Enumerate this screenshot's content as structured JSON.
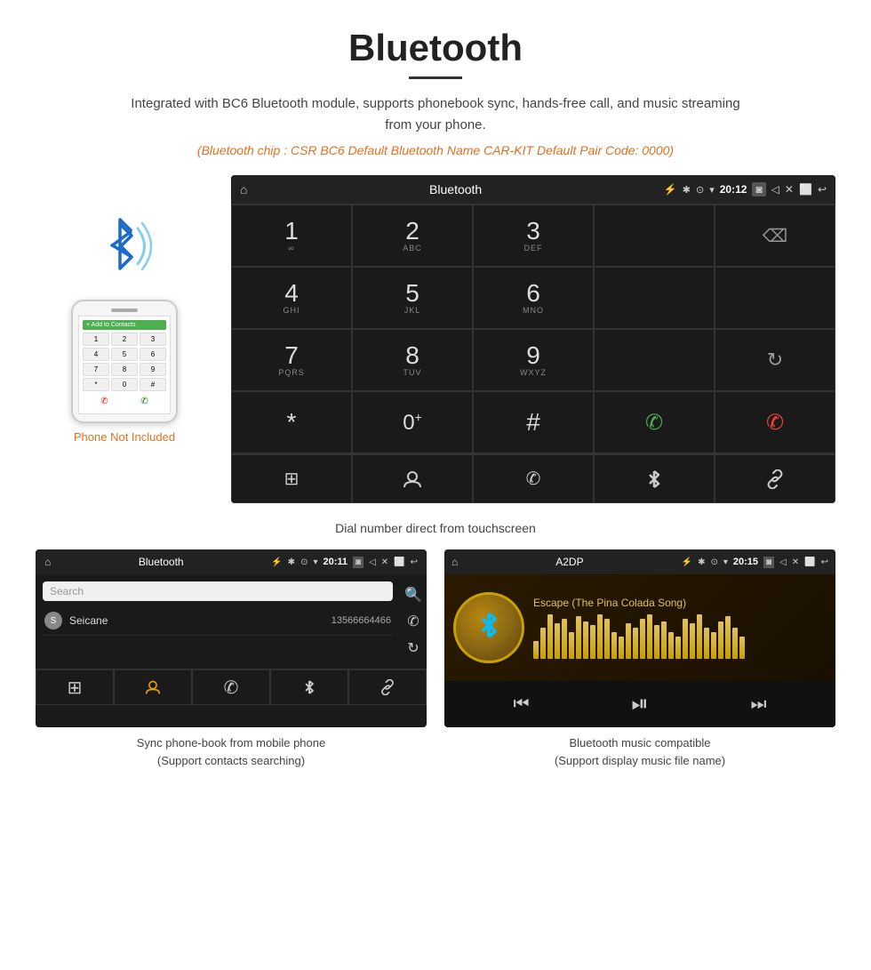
{
  "page": {
    "title": "Bluetooth",
    "title_underline": true,
    "subtitle": "Integrated with BC6 Bluetooth module, supports phonebook sync, hands-free call, and music streaming from your phone.",
    "info_line": "(Bluetooth chip : CSR BC6    Default Bluetooth Name CAR-KIT    Default Pair Code: 0000)"
  },
  "dialer": {
    "status_bar": {
      "home_icon": "⌂",
      "title": "Bluetooth",
      "usb_icon": "⚡",
      "bt_icon": "✱",
      "location_icon": "⊙",
      "signal_icon": "▾",
      "time": "20:12",
      "camera_icon": "◙",
      "volume_icon": "◁",
      "close_icon": "✕",
      "window_icon": "⬜",
      "back_icon": "↩"
    },
    "keys": [
      {
        "number": "1",
        "letters": "∞",
        "row": 0,
        "col": 0
      },
      {
        "number": "2",
        "letters": "ABC",
        "row": 0,
        "col": 1
      },
      {
        "number": "3",
        "letters": "DEF",
        "row": 0,
        "col": 2
      },
      {
        "number": "",
        "letters": "",
        "row": 0,
        "col": 3,
        "empty": true
      },
      {
        "number": "⌫",
        "letters": "",
        "row": 0,
        "col": 4,
        "type": "backspace"
      },
      {
        "number": "4",
        "letters": "GHI",
        "row": 1,
        "col": 0
      },
      {
        "number": "5",
        "letters": "JKL",
        "row": 1,
        "col": 1
      },
      {
        "number": "6",
        "letters": "MNO",
        "row": 1,
        "col": 2
      },
      {
        "number": "",
        "letters": "",
        "row": 1,
        "col": 3,
        "empty": true
      },
      {
        "number": "",
        "letters": "",
        "row": 1,
        "col": 4,
        "empty": true
      },
      {
        "number": "7",
        "letters": "PQRS",
        "row": 2,
        "col": 0
      },
      {
        "number": "8",
        "letters": "TUV",
        "row": 2,
        "col": 1
      },
      {
        "number": "9",
        "letters": "WXYZ",
        "row": 2,
        "col": 2
      },
      {
        "number": "",
        "letters": "",
        "row": 2,
        "col": 3,
        "empty": true
      },
      {
        "number": "↻",
        "letters": "",
        "row": 2,
        "col": 4,
        "type": "rotate"
      },
      {
        "number": "*",
        "letters": "",
        "row": 3,
        "col": 0
      },
      {
        "number": "0",
        "letters": "+",
        "row": 3,
        "col": 1
      },
      {
        "number": "#",
        "letters": "",
        "row": 3,
        "col": 2
      },
      {
        "number": "✆",
        "letters": "",
        "row": 3,
        "col": 3,
        "type": "call-green"
      },
      {
        "number": "✆",
        "letters": "",
        "row": 3,
        "col": 4,
        "type": "call-red"
      }
    ],
    "bottom_icons": [
      "⊞",
      "👤",
      "✆",
      "✱",
      "🔗"
    ],
    "caption": "Dial number direct from touchscreen"
  },
  "phonebook": {
    "status_bar": {
      "home_icon": "⌂",
      "title": "Bluetooth",
      "usb_icon": "⚡",
      "bt_icon": "✱",
      "location_icon": "⊙",
      "signal_icon": "▾",
      "time": "20:11",
      "camera_icon": "◙",
      "volume_icon": "◁",
      "close_icon": "✕",
      "window_icon": "⬜",
      "back_icon": "↩"
    },
    "search_placeholder": "Search",
    "contacts": [
      {
        "letter": "S",
        "name": "Seicane",
        "number": "13566664466"
      }
    ],
    "side_icons": [
      "🔍",
      "✆",
      "↻"
    ],
    "bottom_icons": [
      "⊞",
      "👤",
      "✆",
      "✱",
      "🔗"
    ],
    "caption": "Sync phone-book from mobile phone\n(Support contacts searching)"
  },
  "music": {
    "status_bar": {
      "home_icon": "⌂",
      "title": "A2DP",
      "usb_icon": "⚡",
      "bt_icon": "✱",
      "location_icon": "⊙",
      "signal_icon": "▾",
      "time": "20:15",
      "camera_icon": "◙",
      "volume_icon": "◁",
      "close_icon": "✕",
      "window_icon": "⬜",
      "back_icon": "↩"
    },
    "song_name": "Escape (The Pina Colada Song)",
    "eq_bars": [
      20,
      35,
      50,
      40,
      45,
      30,
      48,
      42,
      38,
      50,
      45,
      30,
      25,
      40,
      35,
      45,
      50,
      38,
      42,
      30,
      25,
      45,
      40,
      50,
      35,
      30,
      42,
      48,
      35,
      25
    ],
    "controls": [
      "⏮",
      "⏯",
      "⏭"
    ],
    "caption": "Bluetooth music compatible\n(Support display music file name)"
  },
  "phone_mockup": {
    "not_included": "Phone Not Included",
    "keys": [
      "1",
      "2",
      "3",
      "4",
      "5",
      "6",
      "7",
      "8",
      "9",
      "*",
      "0",
      "#"
    ],
    "add_contact": "+ Add to Contacts"
  }
}
